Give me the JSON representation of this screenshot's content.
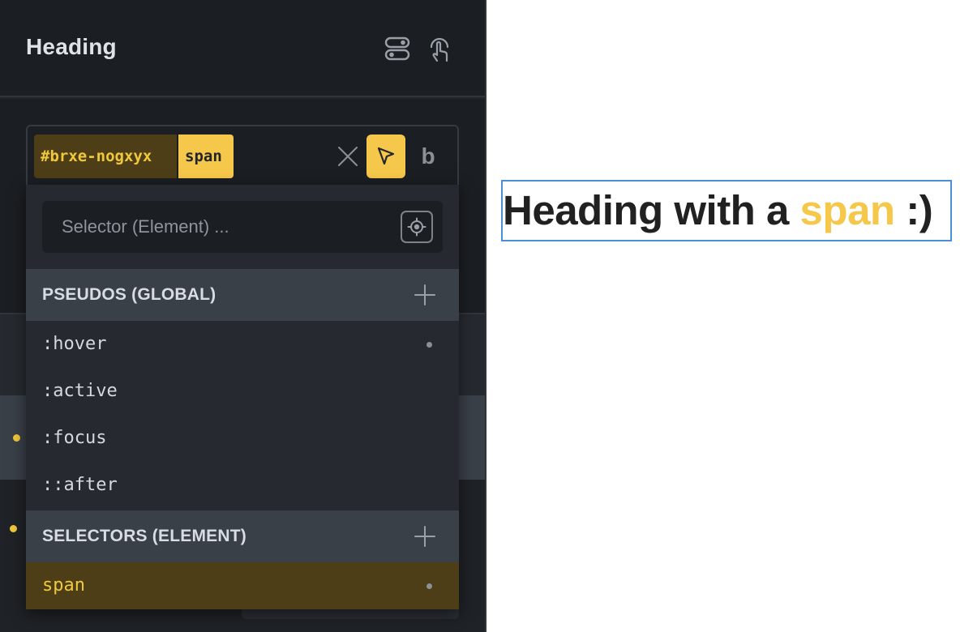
{
  "panel": {
    "title": "Heading",
    "icons": [
      "toggle-stack-icon",
      "hand-pointer-icon"
    ]
  },
  "selector": {
    "id_tag": "#brxe-nogxyx",
    "element_tag": "span",
    "b_label": "b",
    "icons": [
      "close-icon",
      "cursor-pointer-icon"
    ]
  },
  "dropdown": {
    "search_placeholder": "Selector (Element) ...",
    "search_value": "",
    "pseudos": {
      "header": "PSEUDOS (GLOBAL)",
      "items": [
        ":hover",
        ":active",
        ":focus",
        "::after"
      ]
    },
    "selectors": {
      "header": "SELECTORS (ELEMENT)",
      "items": [
        "span"
      ]
    }
  },
  "preview": {
    "heading_before": "Heading with a ",
    "heading_span": "span",
    "heading_after": " :)"
  },
  "colors": {
    "accent": "#f5c74a",
    "panel_bg": "#22262c",
    "selection_border": "#4a90d9"
  }
}
